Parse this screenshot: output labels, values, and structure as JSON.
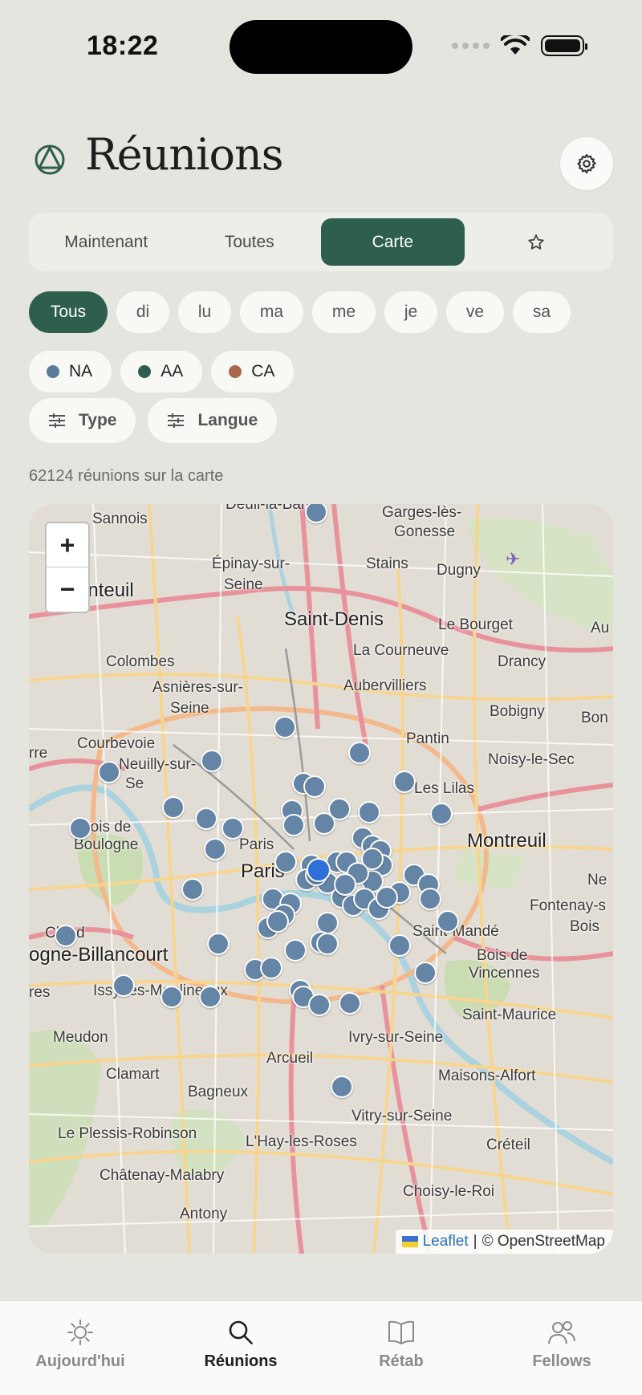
{
  "status": {
    "time": "18:22"
  },
  "header": {
    "title": "Réunions"
  },
  "tabs": [
    {
      "label": "Maintenant",
      "active": false
    },
    {
      "label": "Toutes",
      "active": false
    },
    {
      "label": "Carte",
      "active": true
    },
    {
      "label": "",
      "icon": "star-icon",
      "active": false
    }
  ],
  "days": [
    {
      "label": "Tous",
      "active": true
    },
    {
      "label": "di"
    },
    {
      "label": "lu"
    },
    {
      "label": "ma"
    },
    {
      "label": "me"
    },
    {
      "label": "je"
    },
    {
      "label": "ve"
    },
    {
      "label": "sa"
    }
  ],
  "fellowships": [
    {
      "label": "NA",
      "color": "#5d7b9b"
    },
    {
      "label": "AA",
      "color": "#2e5e4e"
    },
    {
      "label": "CA",
      "color": "#a8694a"
    }
  ],
  "filters": [
    {
      "label": "Type",
      "icon": "sliders-icon"
    },
    {
      "label": "Langue",
      "icon": "sliders-icon"
    }
  ],
  "count_text": "62124 réunions sur la carte",
  "map": {
    "zoom_in": "+",
    "zoom_out": "−",
    "attribution": {
      "leaflet": "Leaflet",
      "separator": "|",
      "osm": "© OpenStreetMap"
    },
    "places": [
      "Sannois",
      "Deuil-la-Barre",
      "Garges-lès-",
      "Gonesse",
      "Épinay-sur-",
      "Seine",
      "Stains",
      "Dugny",
      "enteuil",
      "Saint-Denis",
      "Le Bourget",
      "Colombes",
      "La Courneuve",
      "Drancy",
      "Asnières-sur-",
      "Seine",
      "Aubervilliers",
      "Bobigny",
      "Bon",
      "Courbevoie",
      "Pantin",
      "Noisy-le-Sec",
      "rre",
      "Neuilly-sur-",
      "Se",
      "Les Lilas",
      "Bois de",
      "Boulogne",
      "Paris",
      "Paris",
      "Montreuil",
      "Ne",
      "Fontenay-s",
      "Bois",
      "Cloud",
      "Saint-Mandé",
      "ogne-Billancourt",
      "Bois de",
      "Vincennes",
      "Issy-les-Moulineaux",
      "res",
      "Saint-Maurice",
      "Meudon",
      "Ivry-sur-Seine",
      "Arcueil",
      "Maisons-Alfort",
      "Clamart",
      "Bagneux",
      "Vitry-sur-Seine",
      "Le Plessis-Robinson",
      "L'Hay-les-Roses",
      "Créteil",
      "Châtenay-Malabry",
      "Choisy-le-Roi",
      "Antony",
      "Au"
    ],
    "marker_count": 68
  },
  "tabbar": [
    {
      "label": "Aujourd'hui",
      "icon": "sun-icon",
      "active": false
    },
    {
      "label": "Réunions",
      "icon": "search-icon",
      "active": true
    },
    {
      "label": "Rétab",
      "icon": "book-icon",
      "active": false
    },
    {
      "label": "Fellows",
      "icon": "people-icon",
      "active": false
    }
  ]
}
